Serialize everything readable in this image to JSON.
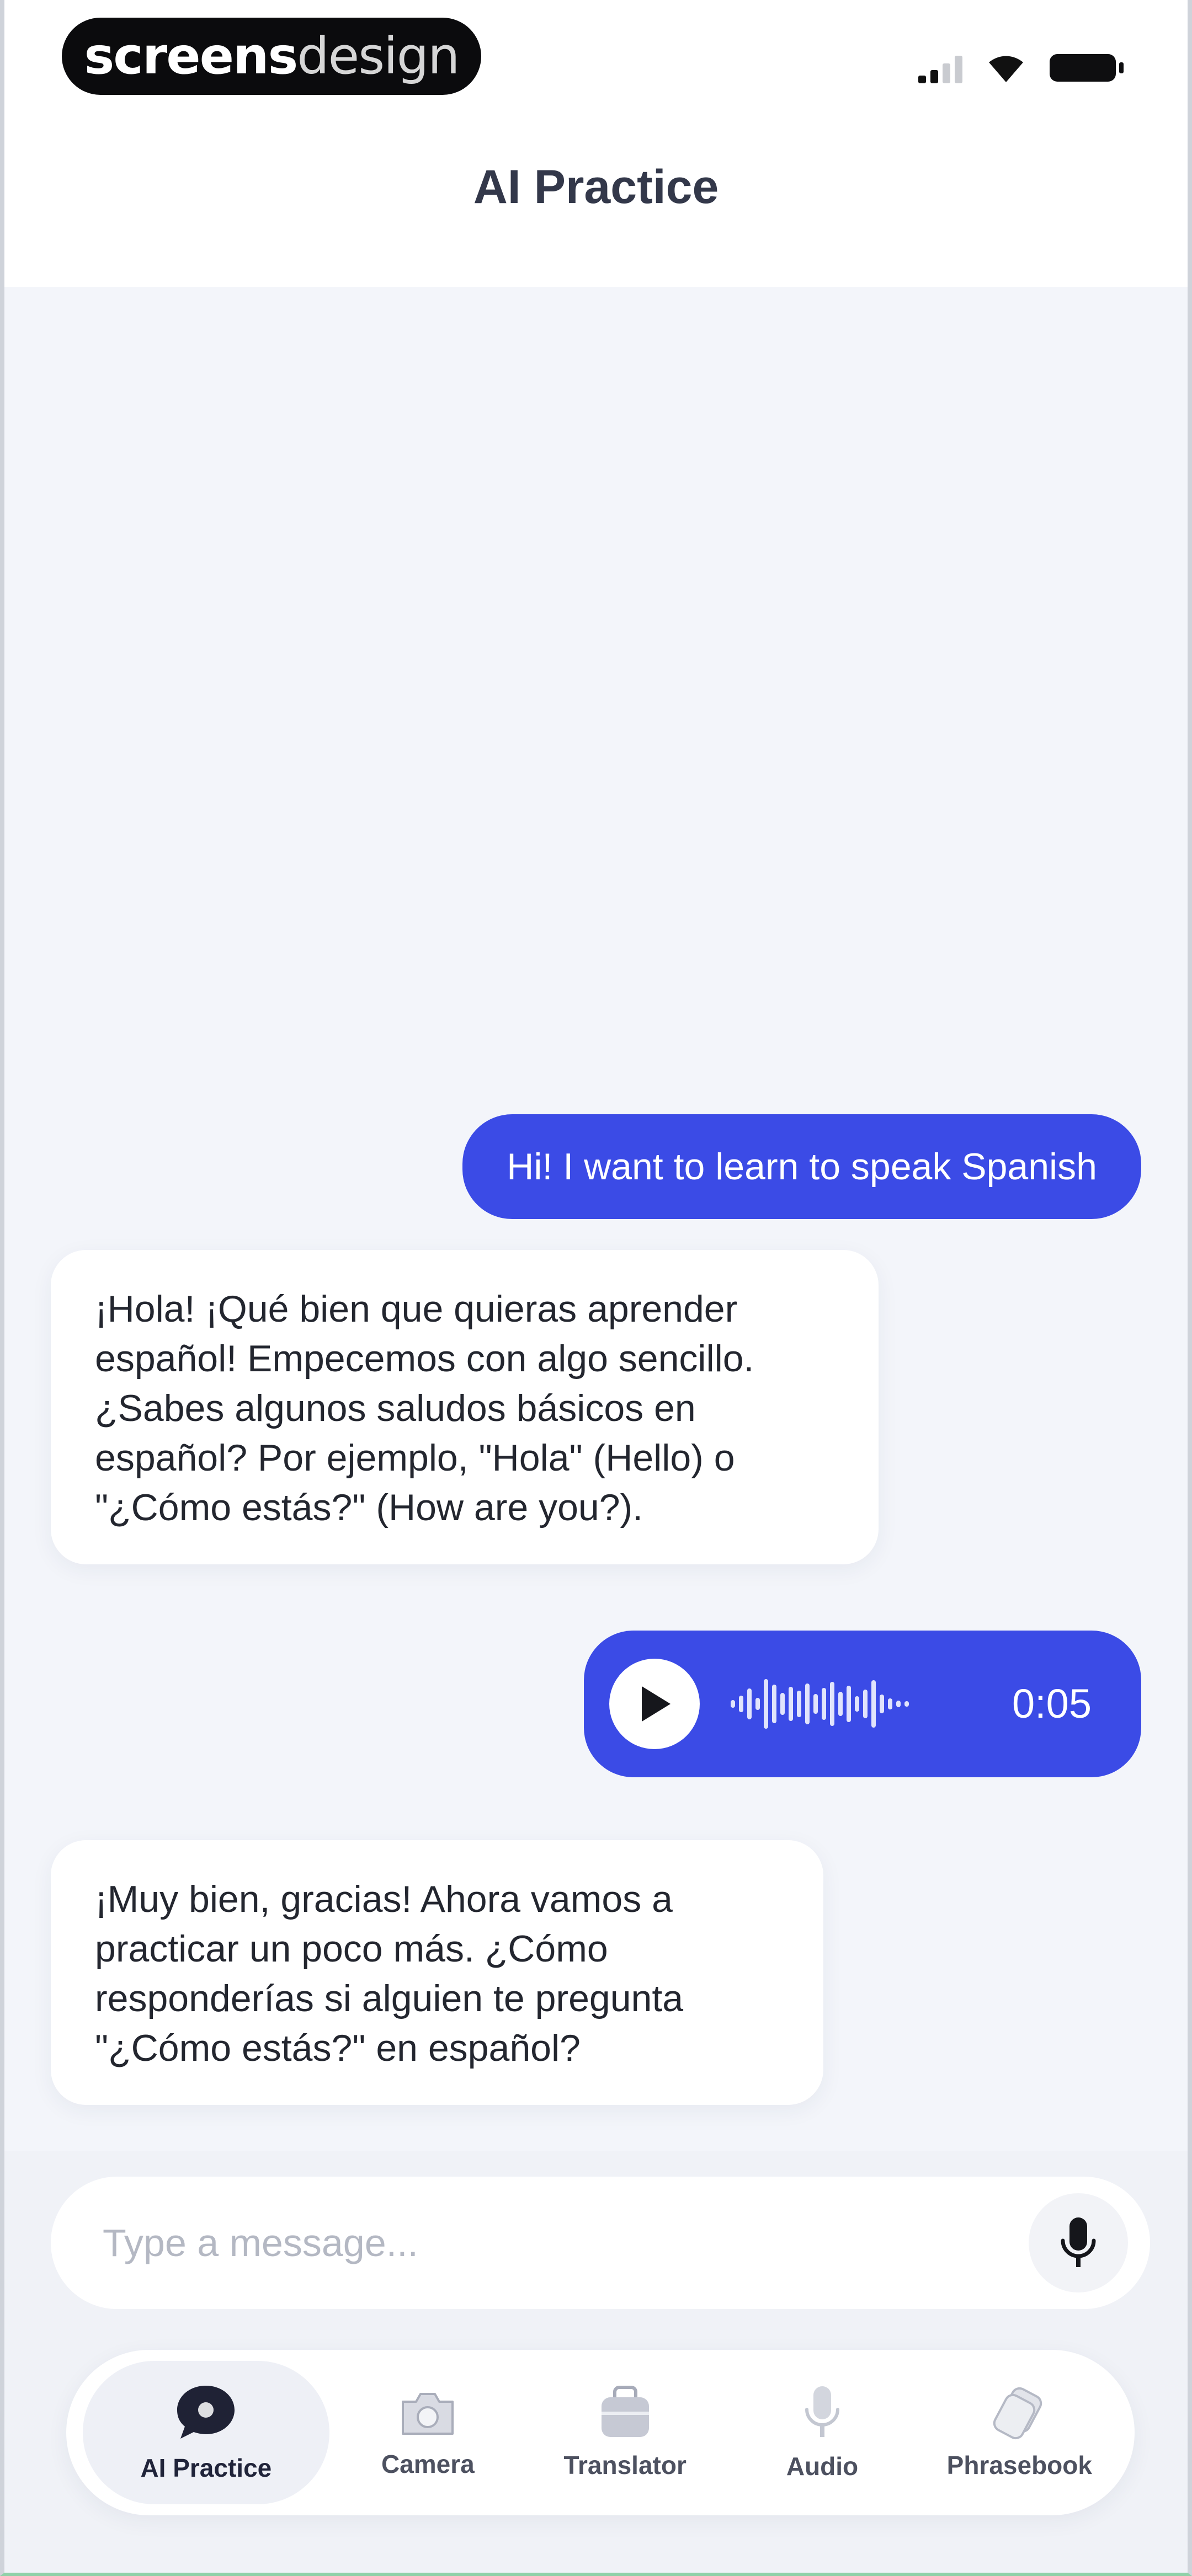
{
  "brand": {
    "bold": "screens",
    "light": "design"
  },
  "header": {
    "title": "AI Practice"
  },
  "messages": [
    {
      "role": "user",
      "kind": "text",
      "text": "Hi! I want to learn to speak Spanish"
    },
    {
      "role": "bot",
      "kind": "text",
      "text": "¡Hola! ¡Qué bien que quieras aprender español! Empecemos con algo sencillo. ¿Sabes algunos saludos básicos en español? Por ejemplo, \"Hola\" (Hello) o \"¿Cómo estás?\" (How are you?)."
    },
    {
      "role": "user",
      "kind": "audio",
      "duration": "0:05"
    },
    {
      "role": "bot",
      "kind": "text",
      "text": "¡Muy bien, gracias! Ahora vamos a practicar un poco más. ¿Cómo responderías si alguien te pregunta \"¿Cómo estás?\" en español?"
    }
  ],
  "composer": {
    "placeholder": "Type a message..."
  },
  "tabs": [
    {
      "label": "AI Practice",
      "icon": "chat-bubble-icon",
      "active": true
    },
    {
      "label": "Camera",
      "icon": "camera-icon",
      "active": false
    },
    {
      "label": "Translator",
      "icon": "translator-icon",
      "active": false
    },
    {
      "label": "Audio",
      "icon": "microphone-icon",
      "active": false
    },
    {
      "label": "Phrasebook",
      "icon": "phrasebook-icon",
      "active": false
    }
  ],
  "colors": {
    "accent": "#3b4be6",
    "background": "#f3f5fa",
    "bot_bubble": "#ffffff"
  }
}
